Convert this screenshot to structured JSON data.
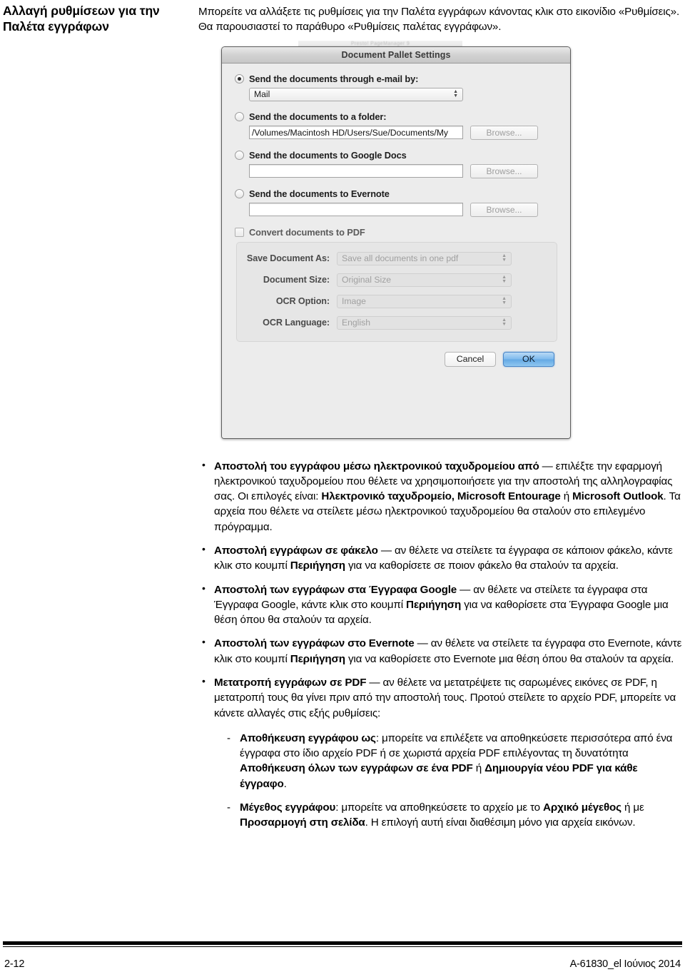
{
  "heading": "Αλλαγή ρυθμίσεων για την Παλέτα εγγράφων",
  "intro": "Μπορείτε να αλλάξετε τις ρυθμίσεις για την Παλέτα εγγράφων κάνοντας κλικ στο εικονίδιο «Ρυθμίσεις». Θα παρουσιαστεί το παράθυρο «Ρυθμίσεις παλέτας εγγράφων».",
  "figure": {
    "ghost_window_title": "Presto! PageManager 9",
    "dialog": {
      "title": "Document Pallet Settings",
      "options": [
        {
          "id": "email",
          "radio_label": "Send the documents through e-mail by:",
          "selected": true,
          "control_type": "popup",
          "value": "Mail",
          "has_browse": false
        },
        {
          "id": "folder",
          "radio_label": "Send the documents to a folder:",
          "selected": false,
          "control_type": "textfield",
          "value": "/Volumes/Macintosh HD/Users/Sue/Documents/My",
          "has_browse": true,
          "browse_label": "Browse..."
        },
        {
          "id": "google-docs",
          "radio_label": "Send the documents to Google Docs",
          "selected": false,
          "control_type": "textfield",
          "value": "",
          "has_browse": true,
          "browse_label": "Browse..."
        },
        {
          "id": "evernote",
          "radio_label": "Send the documents to Evernote",
          "selected": false,
          "control_type": "textfield",
          "value": "",
          "has_browse": true,
          "browse_label": "Browse..."
        }
      ],
      "convert_checkbox": {
        "label": "Convert documents to PDF",
        "checked": false
      },
      "pdf_group": [
        {
          "label": "Save Document As:",
          "value": "Save all documents in one pdf"
        },
        {
          "label": "Document Size:",
          "value": "Original Size"
        },
        {
          "label": "OCR Option:",
          "value": "Image"
        },
        {
          "label": "OCR Language:",
          "value": "English"
        }
      ],
      "buttons": {
        "cancel": "Cancel",
        "ok": "OK"
      },
      "colors": {
        "default_button_blue": "#7fbbee",
        "dialog_background": "#ececec",
        "titlebar": "#d2d2d2"
      }
    }
  },
  "bullets": [
    {
      "id": "email",
      "parts": [
        {
          "text": "Αποστολή του εγγράφου μέσω ηλεκτρονικού ταχυδρομείου από",
          "bold": true
        },
        {
          "text": " — επιλέξτε την εφαρμογή ηλεκτρονικού ταχυδρομείου που θέλετε να χρησιμοποιήσετε για την αποστολή της αλληλογραφίας σας. Οι επιλογές είναι: ",
          "bold": false
        },
        {
          "text": "Ηλεκτρονικό ταχυδρομείο, Microsoft Entourage",
          "bold": true
        },
        {
          "text": " ή ",
          "bold": false
        },
        {
          "text": "Microsoft Outlook",
          "bold": true
        },
        {
          "text": ". Τα αρχεία που θέλετε να στείλετε μέσω ηλεκτρονικού ταχυδρομείου θα σταλούν στο επιλεγμένο πρόγραμμα.",
          "bold": false
        }
      ]
    },
    {
      "id": "folder",
      "parts": [
        {
          "text": "Αποστολή εγγράφων σε φάκελο",
          "bold": true
        },
        {
          "text": " — αν θέλετε να στείλετε τα έγγραφα σε κάποιον φάκελο, κάντε κλικ στο κουμπί ",
          "bold": false
        },
        {
          "text": "Περιήγηση",
          "bold": true
        },
        {
          "text": " για να καθορίσετε σε ποιον φάκελο θα σταλούν τα αρχεία.",
          "bold": false
        }
      ]
    },
    {
      "id": "google-docs",
      "parts": [
        {
          "text": "Αποστολή των εγγράφων στα Έγγραφα Google",
          "bold": true
        },
        {
          "text": " — αν θέλετε να στείλετε τα έγγραφα στα Έγγραφα Google, κάντε κλικ στο κουμπί ",
          "bold": false
        },
        {
          "text": "Περιήγηση",
          "bold": true
        },
        {
          "text": " για να καθορίσετε στα Έγγραφα Google μια θέση όπου θα σταλούν τα αρχεία.",
          "bold": false
        }
      ]
    },
    {
      "id": "evernote",
      "parts": [
        {
          "text": "Αποστολή των εγγράφων στο Evernote",
          "bold": true
        },
        {
          "text": " — αν θέλετε να στείλετε τα έγγραφα στο Evernote, κάντε κλικ στο κουμπί ",
          "bold": false
        },
        {
          "text": "Περιήγηση",
          "bold": true
        },
        {
          "text": " για να καθορίσετε στο Evernote μια θέση όπου θα σταλούν τα αρχεία.",
          "bold": false
        }
      ]
    },
    {
      "id": "pdf",
      "parts": [
        {
          "text": "Μετατροπή εγγράφων σε PDF",
          "bold": true
        },
        {
          "text": " — αν θέλετε να μετατρέψετε τις σαρωμένες εικόνες σε PDF, η μετατροπή τους θα γίνει πριν από την αποστολή τους. Προτού στείλετε το αρχείο PDF, μπορείτε να κάνετε αλλαγές στις εξής ρυθμίσεις:",
          "bold": false
        }
      ],
      "sub_bullets": [
        {
          "id": "save-document-as",
          "parts": [
            {
              "text": "Αποθήκευση εγγράφου ως",
              "bold": true
            },
            {
              "text": ": μπορείτε να επιλέξετε να αποθηκεύσετε περισσότερα από ένα έγγραφα στο ίδιο αρχείο PDF ή σε χωριστά αρχεία PDF επιλέγοντας τη δυνατότητα ",
              "bold": false
            },
            {
              "text": "Αποθήκευση όλων των εγγράφων σε ένα PDF",
              "bold": true
            },
            {
              "text": " ή ",
              "bold": false
            },
            {
              "text": "Δημιουργία νέου PDF για κάθε έγγραφο",
              "bold": true
            },
            {
              "text": ".",
              "bold": false
            }
          ]
        },
        {
          "id": "document-size",
          "parts": [
            {
              "text": "Μέγεθος εγγράφου",
              "bold": true
            },
            {
              "text": ": μπορείτε να αποθηκεύσετε το αρχείο με το ",
              "bold": false
            },
            {
              "text": "Αρχικό μέγεθος",
              "bold": true
            },
            {
              "text": " ή με ",
              "bold": false
            },
            {
              "text": "Προσαρμογή στη σελίδα",
              "bold": true
            },
            {
              "text": ". Η επιλογή αυτή είναι διαθέσιμη μόνο για αρχεία εικόνων.",
              "bold": false
            }
          ]
        }
      ]
    }
  ],
  "footer": {
    "page_number": "2-12",
    "document_id": "A-61830_el  Ιούνιος 2014"
  }
}
